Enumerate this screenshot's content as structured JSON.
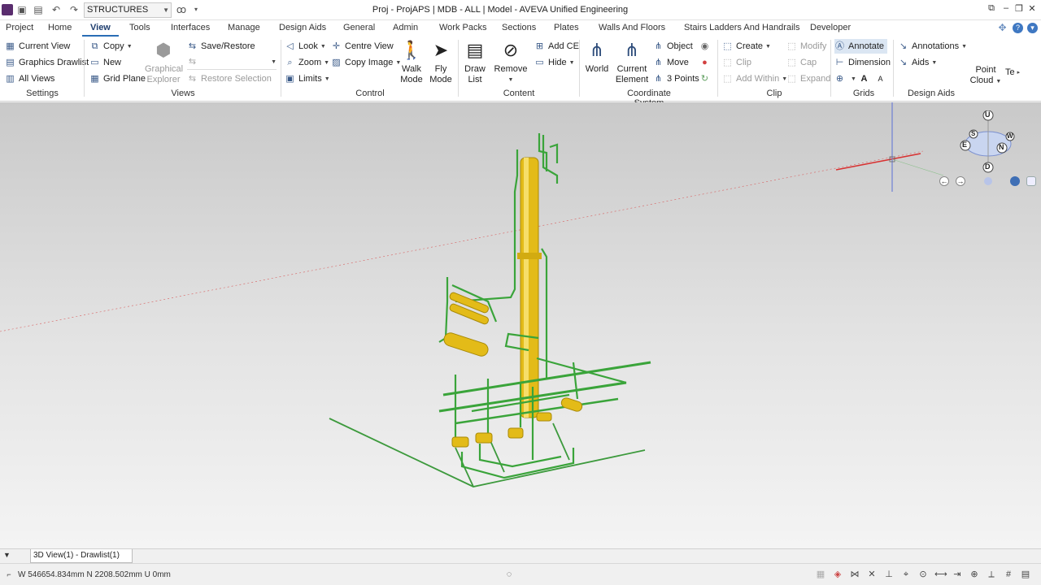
{
  "titlebar": {
    "combo_value": "STRUCTURES",
    "title": "Proj - ProjAPS | MDB - ALL | Model - AVEVA Unified Engineering"
  },
  "menu": {
    "tabs": [
      "Project",
      "Home",
      "View",
      "Tools",
      "Interfaces",
      "Manage",
      "Design Aids",
      "General",
      "Admin",
      "Work Packs",
      "Sections",
      "Plates",
      "Walls And Floors",
      "Stairs Ladders And Handrails",
      "Developer"
    ],
    "active": "View"
  },
  "ribbon": {
    "settings": {
      "label": "Settings",
      "current_view": "Current View",
      "graphics_drawlist": "Graphics Drawlist",
      "all_views": "All Views"
    },
    "views": {
      "label": "Views",
      "copy": "Copy",
      "new": "New",
      "grid_plane": "Grid Plane",
      "graphical": "Graphical",
      "explorer": "Explorer",
      "save_restore": "Save/Restore",
      "restore_selection": "Restore Selection"
    },
    "control": {
      "label": "Control",
      "look": "Look",
      "zoom": "Zoom",
      "limits": "Limits",
      "centre_view": "Centre View",
      "copy_image": "Copy Image",
      "walk": "Walk",
      "walk2": "Mode",
      "fly": "Fly",
      "fly2": "Mode"
    },
    "content": {
      "label": "Content",
      "draw": "Draw",
      "list": "List",
      "remove": "Remove",
      "add_ce": "Add CE",
      "hide": "Hide"
    },
    "coords": {
      "label": "Coordinate System",
      "world": "World",
      "current": "Current",
      "element": "Element",
      "object": "Object",
      "move": "Move",
      "three_points": "3 Points"
    },
    "clip": {
      "label": "Clip",
      "create": "Create",
      "clip": "Clip",
      "add_within": "Add Within",
      "modify": "Modify",
      "cap": "Cap",
      "expand": "Expand"
    },
    "grids": {
      "label": "Grids",
      "annotate": "Annotate",
      "dimension": "Dimension"
    },
    "design_aids": {
      "label": "Design Aids",
      "annotations": "Annotations",
      "aids": "Aids",
      "point": "Point",
      "cloud": "Cloud",
      "te": "Te"
    }
  },
  "viewcube": {
    "u": "U",
    "d": "D",
    "n": "N",
    "e": "E",
    "s": "S",
    "w": "W"
  },
  "doctab": {
    "label": "3D View(1) - Drawlist(1)"
  },
  "status": {
    "coords": "W 546654.834mm N 2208.502mm U 0mm"
  },
  "colors": {
    "pipe_green": "#3aa43a",
    "equipment_yellow": "#e8c21a",
    "axis_red": "#d04040",
    "axis_blue": "#3a5ad0"
  }
}
